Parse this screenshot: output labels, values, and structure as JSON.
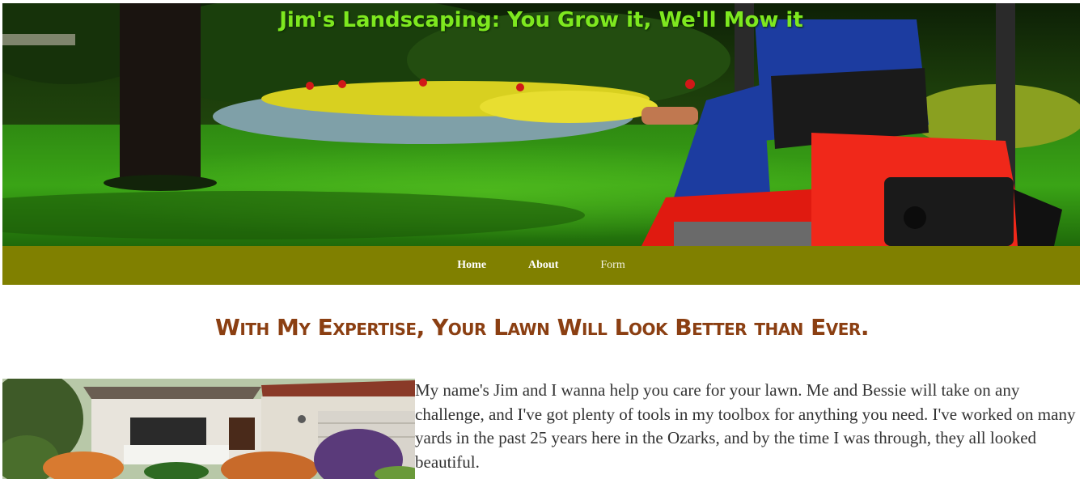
{
  "hero": {
    "title": "Jim's Landscaping: You Grow it, We'll Mow it"
  },
  "nav": {
    "items": [
      {
        "label": "Home"
      },
      {
        "label": "About"
      },
      {
        "label": "Form"
      }
    ]
  },
  "main": {
    "headline": "With My Expertise, Your Lawn Will Look Better than Ever.",
    "intro": "My name's Jim and I wanna help you care for your lawn. Me and Bessie will take on any challenge, and I've got plenty of tools in my toolbox for anything you need. I've worked on many yards in the past 25 years here in the Ozarks, and by the time I was through, they all looked beautiful."
  },
  "colors": {
    "nav_background": "#808000",
    "headline": "#8b3f12",
    "hero_title": "#7ee81f"
  }
}
